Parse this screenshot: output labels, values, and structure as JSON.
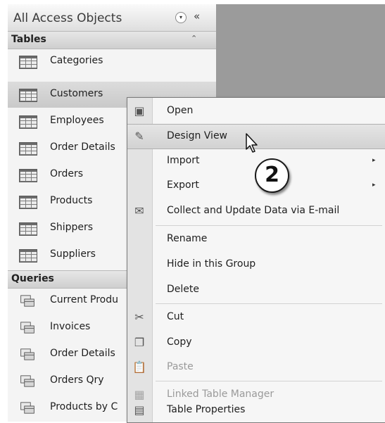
{
  "nav": {
    "title": "All Access Objects",
    "dropdown_glyph": "▾",
    "collapse_glyph": "«",
    "groups": [
      {
        "label": "Tables",
        "chevron": "⌃",
        "items": [
          {
            "label": "Categories",
            "icon": "table-icon"
          },
          {
            "label": "Customers",
            "icon": "table-icon",
            "selected": true
          },
          {
            "label": "Employees",
            "icon": "table-icon"
          },
          {
            "label": "Order Details",
            "icon": "table-icon"
          },
          {
            "label": "Orders",
            "icon": "table-icon"
          },
          {
            "label": "Products",
            "icon": "table-icon"
          },
          {
            "label": "Shippers",
            "icon": "table-icon"
          },
          {
            "label": "Suppliers",
            "icon": "table-icon"
          }
        ]
      },
      {
        "label": "Queries",
        "items": [
          {
            "label": "Current Produ",
            "icon": "query-icon"
          },
          {
            "label": "Invoices",
            "icon": "query-icon"
          },
          {
            "label": "Order Details",
            "icon": "query-icon"
          },
          {
            "label": "Orders Qry",
            "icon": "query-icon"
          },
          {
            "label": "Products by C",
            "icon": "query-icon"
          }
        ]
      }
    ]
  },
  "context_menu": {
    "items": [
      {
        "label": "Open",
        "icon": "open-icon",
        "glyph": "▣"
      },
      {
        "label": "Design View",
        "icon": "design-view-icon",
        "glyph": "✎",
        "highlighted": true
      },
      {
        "label": "Import",
        "submenu": true
      },
      {
        "label": "Export",
        "submenu": true
      },
      {
        "label": "Collect and Update Data via E-mail",
        "icon": "collect-data-icon",
        "glyph": "✉"
      },
      {
        "label": "Rename"
      },
      {
        "label": "Hide in this Group"
      },
      {
        "label": "Delete"
      },
      {
        "label": "Cut",
        "icon": "scissors-icon",
        "glyph": "✂"
      },
      {
        "label": "Copy",
        "icon": "copy-icon",
        "glyph": "❐"
      },
      {
        "label": "Paste",
        "icon": "paste-icon",
        "glyph": "📋",
        "disabled": true
      },
      {
        "label": "Linked Table Manager",
        "icon": "linked-table-icon",
        "glyph": "▦",
        "disabled": true
      },
      {
        "label": "Table Properties",
        "icon": "properties-icon",
        "glyph": "▤"
      }
    ],
    "submenu_glyph": "▸"
  },
  "callout": {
    "number": "2"
  },
  "colors": {
    "workspace": "#9b9b9b",
    "highlight": "#d2d2d2"
  }
}
